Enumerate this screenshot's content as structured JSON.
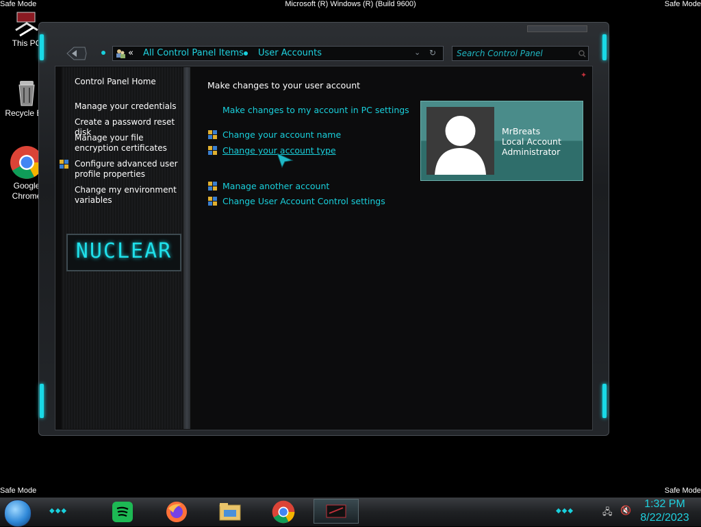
{
  "watermarks": {
    "top_left": "Safe Mode",
    "top_center": "Microsoft (R) Windows (R) (Build 9600)",
    "top_right": "Safe Mode",
    "bottom_left": "Safe Mode",
    "bottom_right": "Safe Mode"
  },
  "desktop": {
    "icons": [
      {
        "label": "This PC"
      },
      {
        "label": "Recycle Bin"
      },
      {
        "label": "Google Chrome"
      }
    ]
  },
  "window": {
    "address": {
      "overflow": "«",
      "crumbs": [
        "All Control Panel Items",
        "User Accounts"
      ]
    },
    "search_placeholder": "Search Control Panel",
    "left_pane": {
      "home": "Control Panel Home",
      "links": [
        "Manage your credentials",
        "Create a password reset disk",
        "Manage your file encryption certificates",
        "Configure advanced user profile properties",
        "Change my environment variables"
      ],
      "logo_text": "NUCLEAR"
    },
    "main": {
      "title": "Make changes to your user account",
      "pc_settings_link": "Make changes to my account in PC settings",
      "tasks": [
        "Change your account name",
        "Change your account type",
        "Manage another account",
        "Change User Account Control settings"
      ]
    },
    "account": {
      "name": "MrBreats",
      "type": "Local Account",
      "role": "Administrator"
    }
  },
  "taskbar": {
    "clock_time": "1:32 PM",
    "clock_date": "8/22/2023"
  },
  "colors": {
    "accent": "#19d0dc",
    "card": "#3f807d"
  }
}
